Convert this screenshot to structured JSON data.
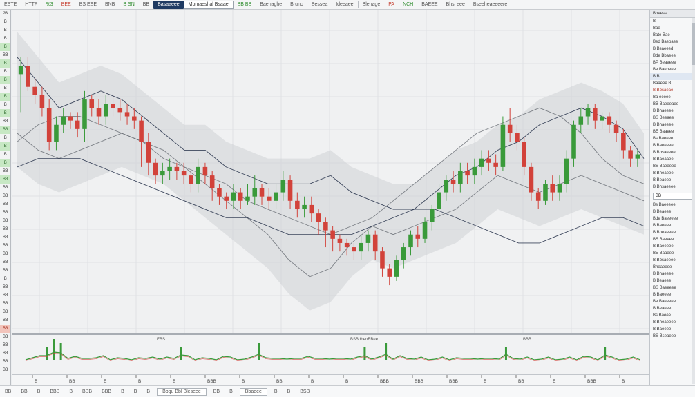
{
  "toolbar": {
    "items": [
      "ESTE",
      "HTTP",
      "%3",
      "BEE",
      "BS EEE",
      "BNB",
      "B SN",
      "BB",
      "BB BB",
      "Baenaghe",
      "Bruno",
      "Bessea",
      "Ideeaee",
      "Blenage",
      "PA",
      "NCH",
      "BAEEE"
    ],
    "colors": [
      "normal",
      "normal",
      "green",
      "red",
      "normal",
      "normal",
      "green",
      "normal",
      "green",
      "normal",
      "normal",
      "normal",
      "normal",
      "normal",
      "red",
      "green",
      "normal"
    ],
    "active_tab": "Mbmaeshal Bsaae",
    "secondary_tab": "Basaaeee",
    "right_items": [
      "Bhsl eee",
      "Bseeheaeeeere"
    ]
  },
  "left_strip": {
    "labels": [
      "2B",
      "B",
      "B",
      "B",
      "B",
      "BB",
      "B",
      "B",
      "B",
      "B",
      "B",
      "B",
      "B",
      "BB",
      "BB",
      "B",
      "B",
      "B",
      "B",
      "BB",
      "BB",
      "BB",
      "BB",
      "BB",
      "BB",
      "BB",
      "BB",
      "BB",
      "BB",
      "BB",
      "BB",
      "BB",
      "B",
      "BB",
      "BB",
      "BB",
      "BB",
      "BB",
      "BB",
      "BB",
      "BB",
      "BB",
      "BB",
      "BB"
    ]
  },
  "right_panel": {
    "header": "Bheess",
    "rows": [
      "B",
      "Bae",
      "Bate Bae",
      "Bed Baebaee",
      "B Bsaeeed",
      "Bde Bbaeee",
      "BP Beaeeee",
      "Be Baebeee",
      "B B",
      "Baaeee B",
      "B Bbsaeae",
      "Ba eeeee",
      "BB Baeeeaee",
      "B Bhaeeee",
      "BS Beeaee",
      "B Bhaeeee",
      "BE Baaeee",
      "Bs Baeeee",
      "B Baeeeee",
      "B Bbsaeeee",
      "B Baeaaee",
      "BS Baeeeee",
      "B Bheaeee",
      "B Beaeee",
      "B Bhsaeeee"
    ],
    "box_label": "BB",
    "lower_rows": [
      "Bs Baeeeee",
      "B Beaeee",
      "Bde Baeeeee",
      "B Baeeee",
      "B Bheaeeee",
      "BS Baeeee",
      "B Baeeeee",
      "BE Baaeee",
      "B Bbsaeeee",
      "Bheaeeee",
      "B Bhaeeee",
      "B Beaeee",
      "BS Baeeeee",
      "B Baeeee",
      "Be Baeeeee",
      "B Beaeee",
      "Bs Baeee",
      "B Bheaeeee",
      "B Baeeee",
      "BS Bseaeee"
    ]
  },
  "sub_chart": {
    "labels": [
      "EBS",
      "BSBdbenBBee",
      "BBB"
    ]
  },
  "bottom_axis": {
    "labels": [
      "B",
      "BB",
      "E",
      "B",
      "B",
      "BBB",
      "B",
      "BB",
      "B",
      "B",
      "BBB",
      "BBB",
      "BBB",
      "B",
      "BB",
      "E",
      "BBB",
      "B"
    ]
  },
  "status_bar": {
    "items": [
      "BB",
      "BB",
      "B",
      "BBB",
      "B",
      "BBB",
      "BBB",
      "B",
      "B",
      "B",
      "Bbgu Bbl Bleseee",
      "BB",
      "B",
      "Bbaeee",
      "B",
      "B",
      "BSB"
    ]
  },
  "colors": {
    "up": "#3a9a3a",
    "down": "#d2423a",
    "band": "#cfd2d6",
    "ma_dark": "#1e2a44",
    "ma_gray": "#6a6f76",
    "grid": "#dfe1e4"
  },
  "chart_data": {
    "type": "candlestick",
    "candles": [
      [
        68,
        70,
        59,
        72
      ],
      [
        70,
        65,
        64,
        72
      ],
      [
        65,
        63,
        61,
        67
      ],
      [
        63,
        60,
        58,
        65
      ],
      [
        60,
        52,
        50,
        62
      ],
      [
        52,
        56,
        50,
        58
      ],
      [
        56,
        58,
        54,
        60
      ],
      [
        58,
        57,
        55,
        59
      ],
      [
        57,
        55,
        53,
        59
      ],
      [
        55,
        62,
        52,
        64
      ],
      [
        62,
        60,
        58,
        63
      ],
      [
        60,
        58,
        56,
        62
      ],
      [
        58,
        61,
        56,
        63
      ],
      [
        61,
        60,
        58,
        63
      ],
      [
        60,
        59,
        57,
        62
      ],
      [
        59,
        58,
        56,
        61
      ],
      [
        58,
        57,
        55,
        60
      ],
      [
        57,
        52,
        46,
        58
      ],
      [
        52,
        47,
        44,
        54
      ],
      [
        47,
        44,
        42,
        48
      ],
      [
        44,
        45,
        42,
        47
      ],
      [
        45,
        46,
        43,
        48
      ],
      [
        46,
        45,
        43,
        47
      ],
      [
        45,
        44,
        42,
        47
      ],
      [
        44,
        42,
        40,
        45
      ],
      [
        42,
        46,
        40,
        48
      ],
      [
        46,
        44,
        42,
        47
      ],
      [
        44,
        41,
        38,
        45
      ],
      [
        41,
        39,
        37,
        42
      ],
      [
        39,
        38,
        36,
        40
      ],
      [
        38,
        40,
        36,
        42
      ],
      [
        40,
        38,
        36,
        41
      ],
      [
        38,
        39,
        37,
        42
      ],
      [
        39,
        41,
        37,
        44
      ],
      [
        41,
        39,
        37,
        42
      ],
      [
        39,
        38,
        36,
        41
      ],
      [
        38,
        40,
        36,
        42
      ],
      [
        40,
        43,
        38,
        45
      ],
      [
        43,
        38,
        36,
        44
      ],
      [
        38,
        36,
        34,
        40
      ],
      [
        36,
        37,
        34,
        39
      ],
      [
        37,
        35,
        33,
        39
      ],
      [
        35,
        33,
        30,
        36
      ],
      [
        33,
        31,
        27,
        34
      ],
      [
        31,
        29,
        26,
        32
      ],
      [
        29,
        28,
        26,
        30
      ],
      [
        28,
        27,
        25,
        29
      ],
      [
        27,
        26,
        24,
        28
      ],
      [
        26,
        28,
        24,
        30
      ],
      [
        28,
        30,
        26,
        31
      ],
      [
        30,
        26,
        24,
        31
      ],
      [
        26,
        22,
        20,
        27
      ],
      [
        22,
        20,
        18,
        23
      ],
      [
        20,
        24,
        19,
        25
      ],
      [
        24,
        27,
        22,
        28
      ],
      [
        27,
        30,
        25,
        31
      ],
      [
        30,
        29,
        27,
        32
      ],
      [
        29,
        33,
        28,
        34
      ],
      [
        33,
        36,
        31,
        37
      ],
      [
        36,
        40,
        34,
        42
      ],
      [
        40,
        43,
        38,
        44
      ],
      [
        43,
        42,
        40,
        45
      ],
      [
        42,
        45,
        40,
        47
      ],
      [
        45,
        44,
        42,
        47
      ],
      [
        44,
        46,
        42,
        48
      ],
      [
        46,
        48,
        44,
        50
      ],
      [
        48,
        47,
        45,
        50
      ],
      [
        47,
        46,
        44,
        49
      ],
      [
        46,
        56,
        45,
        58
      ],
      [
        56,
        54,
        52,
        60
      ],
      [
        54,
        52,
        50,
        56
      ],
      [
        52,
        46,
        44,
        53
      ],
      [
        46,
        40,
        38,
        47
      ],
      [
        40,
        38,
        36,
        41
      ],
      [
        38,
        42,
        37,
        43
      ],
      [
        42,
        40,
        38,
        44
      ],
      [
        40,
        42,
        38,
        44
      ],
      [
        42,
        48,
        40,
        50
      ],
      [
        48,
        56,
        46,
        57
      ],
      [
        56,
        58,
        54,
        60
      ],
      [
        58,
        60,
        56,
        61
      ],
      [
        60,
        57,
        55,
        61
      ],
      [
        57,
        58,
        55,
        59
      ],
      [
        58,
        56,
        54,
        59
      ],
      [
        56,
        54,
        52,
        57
      ],
      [
        54,
        50,
        48,
        55
      ],
      [
        50,
        48,
        46,
        51
      ],
      [
        48,
        49,
        46,
        50
      ]
    ],
    "ma_lines": [
      [
        72,
        66,
        60,
        62,
        64,
        62,
        58,
        54,
        50,
        50,
        46,
        44,
        42,
        42,
        42,
        44,
        40,
        38,
        36,
        36,
        40,
        44,
        46,
        50,
        52,
        56,
        58,
        60,
        58,
        55,
        48
      ],
      [
        52,
        56,
        58,
        58,
        56,
        54,
        52,
        48,
        46,
        44,
        42,
        38,
        36,
        34,
        32,
        30,
        32,
        34,
        38,
        42,
        46,
        50,
        54,
        56,
        58,
        60,
        58,
        54,
        48,
        44,
        42
      ],
      [
        54,
        50,
        48,
        50,
        52,
        54,
        52,
        50,
        46,
        42,
        38,
        34,
        30,
        24,
        20,
        22,
        28,
        32,
        30,
        32,
        34,
        36,
        40,
        44,
        42,
        40,
        42,
        44,
        42,
        40,
        38
      ],
      [
        46,
        48,
        48,
        48,
        46,
        44,
        42,
        40,
        38,
        36,
        34,
        34,
        32,
        30,
        30,
        30,
        30,
        32,
        34,
        36,
        36,
        34,
        32,
        30,
        28,
        28,
        30,
        32,
        34,
        34,
        32
      ]
    ],
    "ylim": [
      10,
      80
    ],
    "sub_bars": [
      0,
      1,
      2,
      3,
      5,
      4,
      1,
      2,
      0,
      1,
      1,
      2,
      0,
      1,
      0,
      0,
      1,
      0,
      2,
      0,
      1,
      1,
      3,
      2,
      0,
      1,
      0,
      0,
      2,
      1,
      0,
      0,
      1,
      4,
      1,
      0,
      1,
      0,
      0,
      1,
      2,
      0,
      1,
      0,
      0,
      1,
      0,
      1,
      3,
      0,
      1,
      4,
      0,
      2,
      1,
      0,
      1,
      0,
      0,
      1,
      0,
      1,
      0,
      1,
      0,
      0,
      1,
      0,
      3,
      1,
      0,
      1,
      0,
      0,
      1,
      0,
      0,
      1,
      0,
      2,
      1,
      0,
      3,
      1,
      0,
      0,
      1,
      0
    ]
  }
}
